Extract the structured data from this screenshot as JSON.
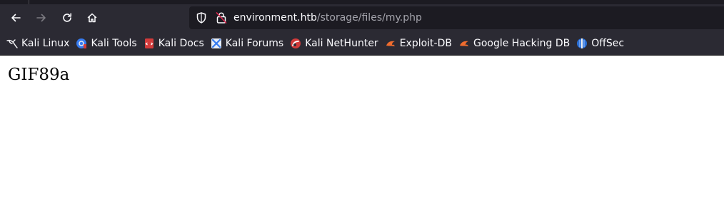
{
  "toolbar": {
    "url_host": "environment.htb",
    "url_path": "/storage/files/my.php"
  },
  "bookmarks": [
    {
      "label": "Kali Linux",
      "icon": "kali-dragon-icon"
    },
    {
      "label": "Kali Tools",
      "icon": "kali-tools-icon"
    },
    {
      "label": "Kali Docs",
      "icon": "kali-docs-icon"
    },
    {
      "label": "Kali Forums",
      "icon": "kali-forums-icon"
    },
    {
      "label": "Kali NetHunter",
      "icon": "kali-nethunter-icon"
    },
    {
      "label": "Exploit-DB",
      "icon": "exploit-db-icon"
    },
    {
      "label": "Google Hacking DB",
      "icon": "google-hacking-db-icon"
    },
    {
      "label": "OffSec",
      "icon": "offsec-icon"
    }
  ],
  "page": {
    "body_text": "GIF89a"
  },
  "colors": {
    "chrome_bg": "#2b2a33",
    "urlbar_bg": "#1c1b22",
    "chrome_text": "#fbfbfe",
    "url_path_text": "#a3a3ab",
    "page_bg": "#ffffff"
  }
}
